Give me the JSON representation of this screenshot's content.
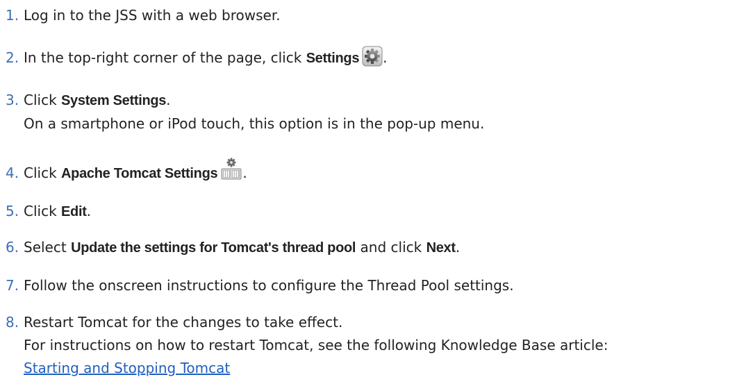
{
  "steps": [
    {
      "num": "1.",
      "text": "Log in to the JSS with a web browser."
    },
    {
      "num": "2.",
      "pre": "In the top-right corner of the page, click ",
      "bold": "Settings",
      "post": "."
    },
    {
      "num": "3.",
      "pre": "Click ",
      "bold": "System Settings",
      "post": ".",
      "note": "On a smartphone or iPod touch, this option is in the pop-up menu."
    },
    {
      "num": "4.",
      "pre": "Click ",
      "bold": "Apache Tomcat Settings",
      "post": "."
    },
    {
      "num": "5.",
      "pre": "Click ",
      "bold": "Edit",
      "post": "."
    },
    {
      "num": "6.",
      "pre": "Select ",
      "bold": "Update the settings for Tomcat's thread pool",
      "mid": " and click ",
      "bold2": "Next",
      "post": "."
    },
    {
      "num": "7.",
      "text": "Follow the onscreen instructions to configure the Thread Pool settings."
    },
    {
      "num": "8.",
      "text": "Restart Tomcat for the changes to take effect.",
      "note": "For instructions on how to restart Tomcat, see the following Knowledge Base article:",
      "link": "Starting and Stopping Tomcat"
    }
  ],
  "icons": {
    "settings": "gear-icon",
    "tomcat": "tomcat-server-icon"
  },
  "colors": {
    "number": "#3b6fb6",
    "link": "#1f5fbf",
    "text": "#222222"
  }
}
